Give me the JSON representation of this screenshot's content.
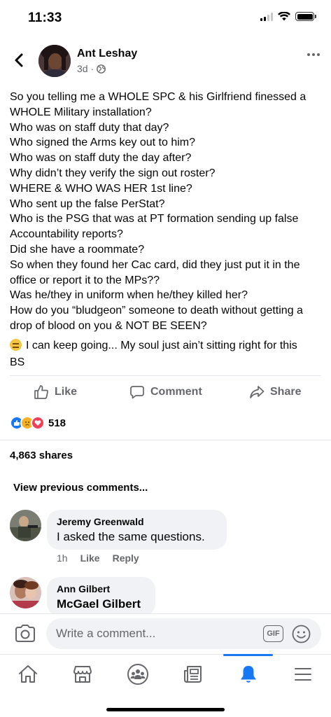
{
  "status_bar": {
    "time": "11:33"
  },
  "post": {
    "author": "Ant Leshay",
    "meta": "3d ·",
    "lines": [
      "So you telling me a WHOLE SPC & his Girlfriend finessed a",
      "WHOLE Military installation?",
      "Who was on staff duty that day?",
      "Who signed the Arms key out to him?",
      "Who was on staff duty the day after?",
      "Why didn’t they verify the sign out roster?",
      "WHERE & WHO WAS HER 1st line?",
      "Who sent up the false PerStat?",
      "Who is the PSG that was at PT formation sending up false",
      "Accountability reports?",
      "Did she have a roommate?",
      "So when they found her Cac card, did they just put it in the",
      "office or report it to the MPs??",
      "Was he/they in uniform when he/they killed her?",
      "How do you “bludgeon” someone to death without getting a",
      "drop of blood on you & NOT BE SEEN?"
    ],
    "closing_line1": "I can keep going... My soul just ain’t sitting right for this",
    "closing_line2": "BS"
  },
  "actions": {
    "like": "Like",
    "comment": "Comment",
    "share": "Share"
  },
  "reactions": {
    "count": "518"
  },
  "shares": "4,863 shares",
  "view_previous": "View previous comments...",
  "comments": [
    {
      "name": "Jeremy Greenwald",
      "text": "I asked the same questions.",
      "time": "1h",
      "like": "Like",
      "reply": "Reply"
    },
    {
      "name": "Ann Gilbert",
      "text": "McGael Gilbert"
    }
  ],
  "composer": {
    "placeholder": "Write a comment...",
    "gif_label": "GIF"
  },
  "colors": {
    "accent": "#1877f2",
    "secondary_text": "#65676b",
    "bubble": "#f0f2f5"
  }
}
